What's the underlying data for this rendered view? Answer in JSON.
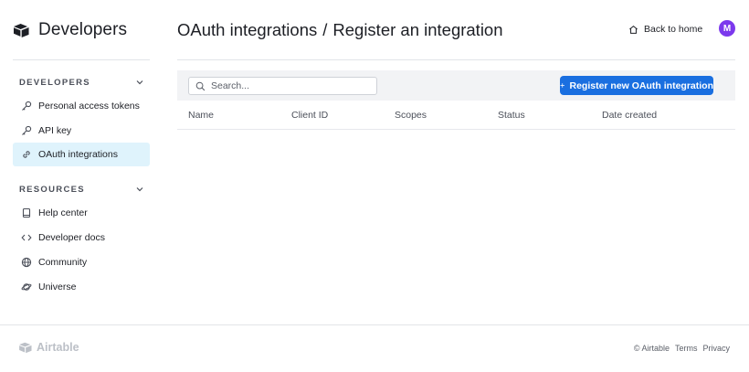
{
  "brand": {
    "name": "Developers",
    "icon": "airtable-box-icon"
  },
  "sidebar": {
    "sections": [
      {
        "title": "DEVELOPERS",
        "items": [
          {
            "label": "Personal access tokens",
            "icon": "key-icon",
            "active": false
          },
          {
            "label": "API key",
            "icon": "key-icon",
            "active": false
          },
          {
            "label": "OAuth integrations",
            "icon": "link-icon",
            "active": true
          }
        ]
      },
      {
        "title": "RESOURCES",
        "items": [
          {
            "label": "Help center",
            "icon": "book-icon",
            "active": false
          },
          {
            "label": "Developer docs",
            "icon": "code-icon",
            "active": false
          },
          {
            "label": "Community",
            "icon": "globe-icon",
            "active": false
          },
          {
            "label": "Universe",
            "icon": "planet-icon",
            "active": false
          }
        ]
      }
    ]
  },
  "header": {
    "breadcrumb": [
      "OAuth integrations",
      "Register an integration"
    ],
    "separator": "/",
    "back_label": "Back to home",
    "avatar_initial": "M"
  },
  "toolbar": {
    "search_placeholder": "Search...",
    "register_label": "Register new OAuth integration"
  },
  "table": {
    "columns": [
      "Name",
      "Client ID",
      "Scopes",
      "Status",
      "Date created"
    ],
    "rows": []
  },
  "footer": {
    "logo_text": "Airtable",
    "copyright": "© Airtable",
    "links": [
      "Terms",
      "Privacy"
    ]
  },
  "colors": {
    "accent": "#1a6fe0",
    "active_bg": "#dff3fc",
    "avatar": "#7c39ed"
  }
}
